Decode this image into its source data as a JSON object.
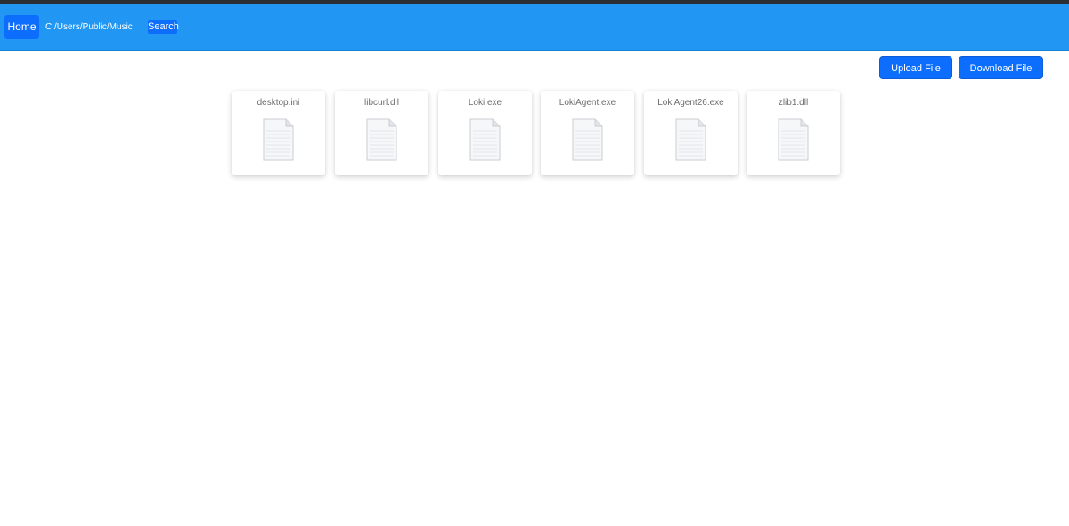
{
  "navbar": {
    "home_label": "Home",
    "path": "C:/Users/Public/Music",
    "search_label": "Search",
    "color": "#2196f3",
    "button_color": "#0d6efd"
  },
  "actions": {
    "upload_label": "Upload File",
    "download_label": "Download File"
  },
  "files": [
    {
      "name": "desktop.ini",
      "icon": "document-icon"
    },
    {
      "name": "libcurl.dll",
      "icon": "document-icon"
    },
    {
      "name": "Loki.exe",
      "icon": "document-icon"
    },
    {
      "name": "LokiAgent.exe",
      "icon": "document-icon"
    },
    {
      "name": "LokiAgent26.exe",
      "icon": "document-icon"
    },
    {
      "name": "zlib1.dll",
      "icon": "document-icon"
    }
  ]
}
